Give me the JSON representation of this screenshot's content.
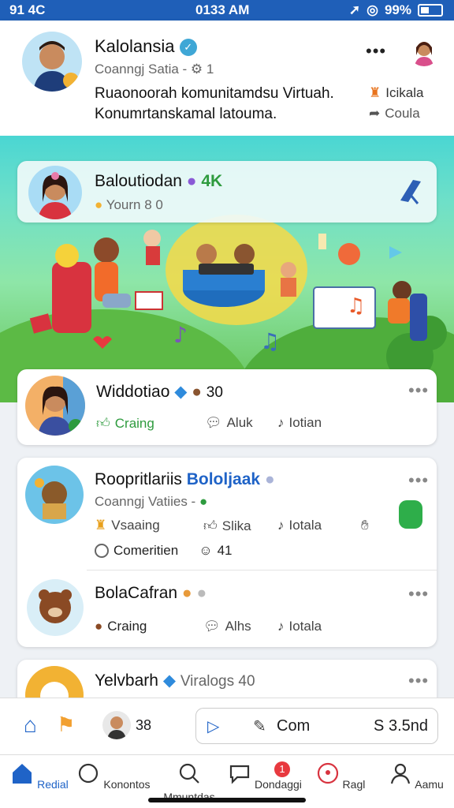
{
  "status": {
    "left": "91 4C",
    "time": "0133 AM",
    "battery": "99%"
  },
  "profile": {
    "name": "Kalolansia",
    "meta": "Coanngj Satia -",
    "meta_count": "1",
    "bio_line1": "Ruaonoorah komunitamdsu Virtuah.",
    "bio_line2": "Konumrtanskamal latouma.",
    "side_action1": "Icikala",
    "side_action2": "Coula"
  },
  "featured": {
    "name": "Baloutiodan",
    "count": "4K",
    "sub": "Yourn 8 0"
  },
  "posts": [
    {
      "name": "Widdotiao",
      "count": "30",
      "act1": "Craing",
      "act2": "Aluk",
      "act3": "Iotian"
    },
    {
      "name": "Roopritlariis",
      "tag": "Bololjaak",
      "meta": "Coanngj Vatiies -",
      "act1": "Vsaaing",
      "act2": "Slika",
      "act3": "Iotala",
      "comment_label": "Comeritien",
      "comment_count": "41"
    },
    {
      "name": "BolaCafran",
      "act1": "Craing",
      "act2": "Alhs",
      "act3": "Iotala"
    },
    {
      "name": "Yelvbarh",
      "meta": "Viralogs 40"
    }
  ],
  "composer": {
    "count": "38",
    "compose_label": "Com",
    "amount": "S 3.5nd"
  },
  "tabs": [
    "Redial",
    "Konontos",
    "Mmuntdas",
    "Dondaggi",
    "Ragl",
    "Aamu"
  ],
  "tab_badge": "1",
  "colors": {
    "accent": "#1f63c7",
    "green": "#2e9b3e"
  }
}
